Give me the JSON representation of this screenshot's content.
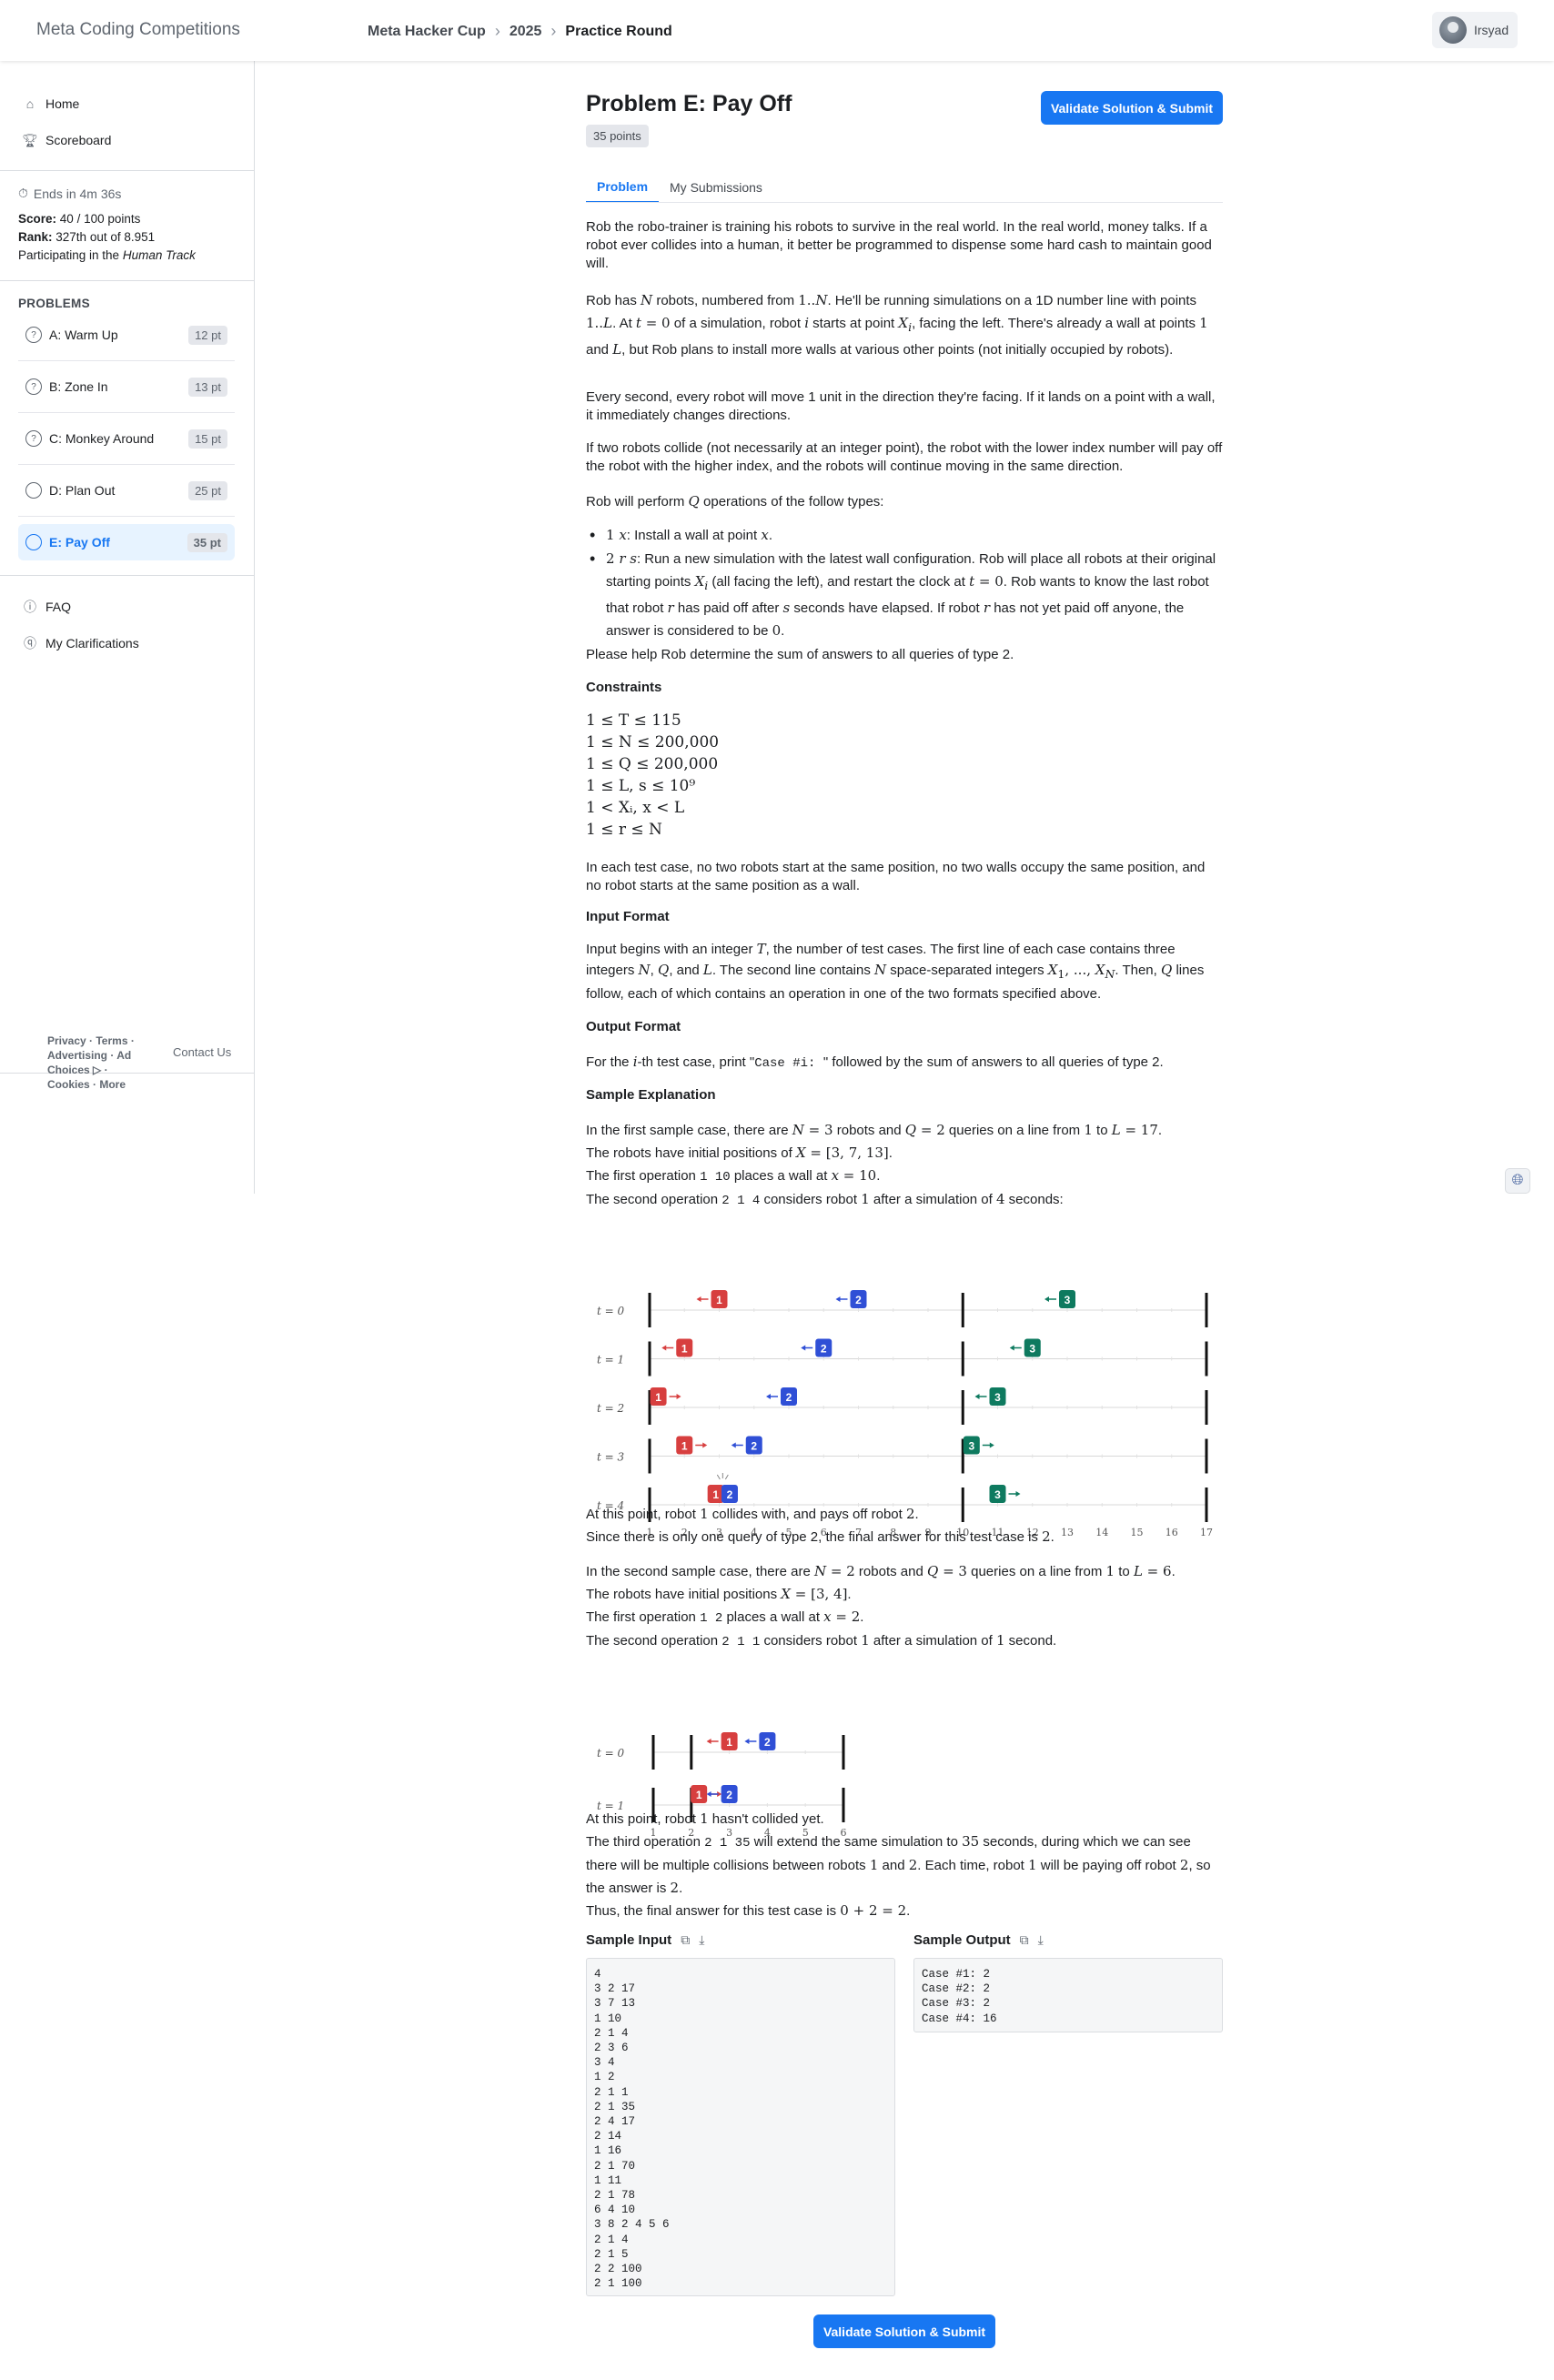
{
  "header": {
    "brand": "Meta Coding Competitions",
    "breadcrumb": [
      "Meta Hacker Cup",
      "2025",
      "Practice Round"
    ],
    "user": "Irsyad"
  },
  "sidebar": {
    "nav": [
      {
        "label": "Home",
        "icon": "home-icon"
      },
      {
        "label": "Scoreboard",
        "icon": "trophy-icon"
      }
    ],
    "timer": "Ends in 4m 36s",
    "score_label": "Score:",
    "score_value": "40 / 100 points",
    "rank_label": "Rank:",
    "rank_value": "327th out of 8.951",
    "track_prefix": "Participating in the ",
    "track_name": "Human Track",
    "problems_title": "PROBLEMS",
    "problems": [
      {
        "label": "A: Warm Up",
        "points": "12 pt",
        "status": "solved"
      },
      {
        "label": "B: Zone In",
        "points": "13 pt",
        "status": "solved"
      },
      {
        "label": "C: Monkey Around",
        "points": "15 pt",
        "status": "solved"
      },
      {
        "label": "D: Plan Out",
        "points": "25 pt",
        "status": "unsolved"
      },
      {
        "label": "E: Pay Off",
        "points": "35 pt",
        "status": "unsolved"
      }
    ],
    "bottom_nav": [
      {
        "label": "FAQ",
        "icon": "info-icon"
      },
      {
        "label": "My Clarifications",
        "icon": "clarification-icon"
      }
    ],
    "footer_links": "Privacy · Terms · Advertising · Ad Choices ▷ · Cookies · More",
    "footer_contact": "Contact Us"
  },
  "problem": {
    "title": "Problem E: Pay Off",
    "points": "35 points",
    "submit_label": "Validate Solution & Submit",
    "tabs": [
      "Problem",
      "My Submissions"
    ],
    "intro": "Rob the robo-trainer is training his robots to survive in the real world. In the real world, money talks. If a robot ever collides into a human, it better be programmed to dispense some hard cash to maintain good will.",
    "p2_a": "Rob has ",
    "p2_b": " robots, numbered from ",
    "p2_c": ". He'll be running simulations on a 1D number line with points ",
    "p2_d": ". At ",
    "p2_e": " of a simulation, robot ",
    "p2_f": " starts at point ",
    "p2_g": ", facing the left. There's already a wall at points ",
    "p2_h": " and ",
    "p2_i": ", but Rob plans to install more walls at various other points (not initially occupied by robots).",
    "p3": "Every second, every robot will move 1 unit in the direction they're facing. If it lands on a point with a wall, it immediately changes directions.",
    "p4": "If two robots collide (not necessarily at an integer point), the robot with the lower index number will pay off the robot with the higher index, and the robots will continue moving in the same direction.",
    "p5_a": "Rob will perform ",
    "p5_b": " operations of the follow types:",
    "b1_a": ": Install a wall at point ",
    "b2_a": ": Run a new simulation with the latest wall configuration. Rob will place all robots at their original starting points ",
    "b2_b": " (all facing the left), and restart the clock at ",
    "b2_c": ". Rob wants to know the last robot that robot ",
    "b2_d": " has paid off after ",
    "b2_e": " seconds have elapsed. If robot ",
    "b2_f": " has not yet paid off anyone, the answer is considered to be ",
    "p6": "Please help Rob determine the sum of answers to all queries of type 2.",
    "constraints_title": "Constraints",
    "constraints": [
      "1 ≤ T ≤ 115",
      "1 ≤ N ≤ 200,000",
      "1 ≤ Q ≤ 200,000",
      "1 ≤ L, s ≤ 10⁹",
      "1 < Xᵢ, x < L",
      "1 ≤ r ≤ N"
    ],
    "p7": "In each test case, no two robots start at the same position, no two walls occupy the same position, and no robot starts at the same position as a wall.",
    "input_title": "Input Format",
    "in_a": "Input begins with an integer ",
    "in_b": ", the number of test cases. The first line of each case contains three integers ",
    "in_c": ", and ",
    "in_d": ". The second line contains ",
    "in_e": " space-separated integers ",
    "in_f": ". Then, ",
    "in_g": " lines follow, each of which contains an operation in one of the two formats specified above.",
    "output_title": "Output Format",
    "out_a": "For the ",
    "out_b": "-th test case, print \"",
    "out_code": "Case #i: ",
    "out_c": "\" followed by the sum of answers to all queries of type 2.",
    "expl_title": "Sample Explanation",
    "e1_l1a": "In the first sample case, there are ",
    "e1_l1b": " robots and ",
    "e1_l1c": " queries on a line from ",
    "e1_l1d": " to ",
    "e1_l2": "The robots have initial positions of ",
    "e1_l3a": "The first operation ",
    "e1_l3code": "1 10",
    "e1_l3b": " places a wall at ",
    "e1_l4a": "The second operation ",
    "e1_l4code": "2 1 4",
    "e1_l4b": " considers robot ",
    "e1_l4c": " after a simulation of ",
    "e1_l4d": " seconds:",
    "e1_after1a": "At this point, robot ",
    "e1_after1b": " collides with, and pays off robot ",
    "e1_after2a": "Since there is only one query of type 2, the final answer for this test case is ",
    "e2_l1a": "In the second sample case, there are ",
    "e2_l1b": " robots and ",
    "e2_l1c": " queries on a line from ",
    "e2_l1d": " to ",
    "e2_l2": "The robots have initial positions ",
    "e2_l3a": "The first operation ",
    "e2_l3code": "1 2",
    "e2_l3b": " places a wall at ",
    "e2_l4a": "The second operation ",
    "e2_l4code": "2 1 1",
    "e2_l4b": " considers robot ",
    "e2_l4c": " after a simulation of ",
    "e2_l4d": " second.",
    "e2_after1a": "At this point, robot ",
    "e2_after1b": " hasn't collided yet.",
    "e2_after2a": "The third operation ",
    "e2_after2code": "2 1 35",
    "e2_after2b": " will extend the same simulation to ",
    "e2_after2c": " seconds, during which we can see there will be multiple collisions between robots ",
    "e2_after2d": " and ",
    "e2_after2e": ". Each time, robot ",
    "e2_after2f": " will be paying off robot ",
    "e2_after2g": ", so the answer is ",
    "e2_after3": "Thus, the final answer for this test case is ",
    "sample_input_title": "Sample Input",
    "sample_output_title": "Sample Output",
    "sample_input": "4\n3 2 17\n3 7 13\n1 10\n2 1 4\n2 3 6\n3 4\n1 2\n2 1 1\n2 1 35\n2 4 17\n2 14\n1 16\n2 1 70\n1 11\n2 1 78\n6 4 10\n3 8 2 4 5 6\n2 1 4\n2 1 5\n2 2 100\n2 1 100",
    "sample_output": "Case #1: 2\nCase #2: 2\nCase #3: 2\nCase #4: 16"
  },
  "diagram1": {
    "axis_min": 1,
    "axis_max": 17,
    "walls": [
      1,
      10,
      17
    ],
    "ticks": [
      "1",
      "2",
      "3",
      "4",
      "5",
      "6",
      "7",
      "8",
      "9",
      "10",
      "11",
      "12",
      "13",
      "14",
      "15",
      "16",
      "17"
    ],
    "rows": [
      {
        "label": "t = 0",
        "robots": [
          {
            "id": "1",
            "pos": 3,
            "dir": "left"
          },
          {
            "id": "2",
            "pos": 7,
            "dir": "left"
          },
          {
            "id": "3",
            "pos": 13,
            "dir": "left"
          }
        ]
      },
      {
        "label": "t = 1",
        "robots": [
          {
            "id": "1",
            "pos": 2,
            "dir": "left"
          },
          {
            "id": "2",
            "pos": 6,
            "dir": "left"
          },
          {
            "id": "3",
            "pos": 12,
            "dir": "left"
          }
        ]
      },
      {
        "label": "t = 2",
        "robots": [
          {
            "id": "1",
            "pos": 1.25,
            "dir": "right"
          },
          {
            "id": "2",
            "pos": 5,
            "dir": "left"
          },
          {
            "id": "3",
            "pos": 11,
            "dir": "left"
          }
        ]
      },
      {
        "label": "t = 3",
        "robots": [
          {
            "id": "1",
            "pos": 2,
            "dir": "right"
          },
          {
            "id": "2",
            "pos": 4,
            "dir": "left"
          },
          {
            "id": "3",
            "pos": 10.25,
            "dir": "right"
          }
        ]
      },
      {
        "label": "t = 4",
        "robots": [
          {
            "id": "1",
            "pos": 2.9,
            "dir": "none"
          },
          {
            "id": "2",
            "pos": 3.3,
            "dir": "none"
          },
          {
            "id": "3",
            "pos": 11,
            "dir": "right"
          }
        ],
        "collision": true
      }
    ]
  },
  "diagram2": {
    "axis_min": 1,
    "axis_max": 6,
    "walls": [
      1,
      2,
      6
    ],
    "ticks": [
      "1",
      "2",
      "3",
      "4",
      "5",
      "6"
    ],
    "rows": [
      {
        "label": "t = 0",
        "robots": [
          {
            "id": "1",
            "pos": 3,
            "dir": "left"
          },
          {
            "id": "2",
            "pos": 4,
            "dir": "left"
          }
        ]
      },
      {
        "label": "t = 1",
        "robots": [
          {
            "id": "1",
            "pos": 2.2,
            "dir": "right"
          },
          {
            "id": "2",
            "pos": 3,
            "dir": "left"
          }
        ]
      }
    ]
  },
  "colors": {
    "robot1": "#d73f3f",
    "robot2": "#2f4fd6",
    "robot3": "#0e7a5f",
    "accent": "#1877f2"
  }
}
